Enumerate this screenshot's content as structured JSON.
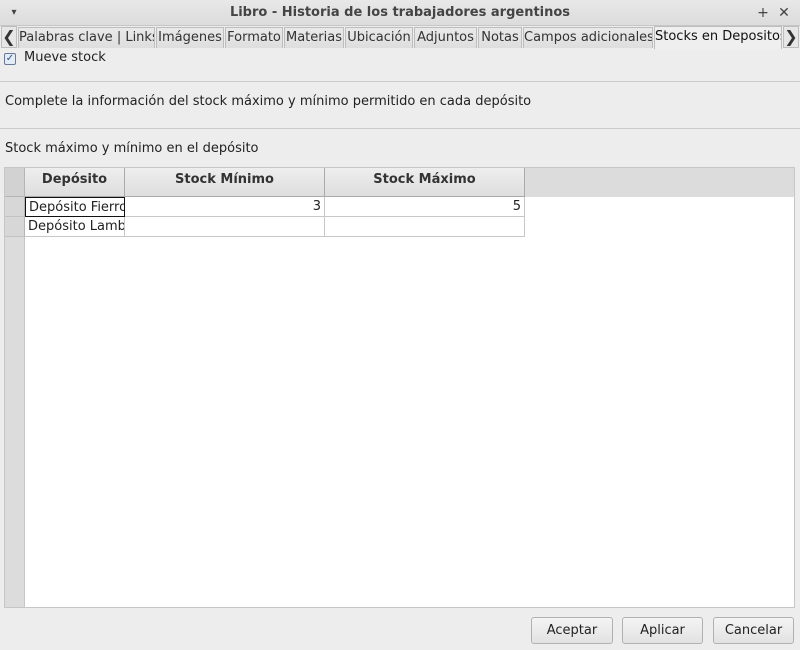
{
  "window": {
    "title": "Libro - Historia de los trabajadores argentinos",
    "menu_glyph": "▾",
    "maximize_glyph": "+",
    "close_glyph": "✕"
  },
  "tabs": {
    "left_arrow": "❮",
    "right_arrow": "❯",
    "items": [
      {
        "label": "Palabras clave | Links"
      },
      {
        "label": "Imágenes"
      },
      {
        "label": "Formato"
      },
      {
        "label": "Materias"
      },
      {
        "label": "Ubicación"
      },
      {
        "label": "Adjuntos"
      },
      {
        "label": "Notas"
      },
      {
        "label": "Campos adicionales"
      },
      {
        "label": "Stocks en Depositos"
      }
    ],
    "active": "Stocks en Depositos"
  },
  "form": {
    "checkbox_label": "Mueve stock",
    "checkbox_checked": true,
    "check_glyph": "✓",
    "info_text": "Complete la información del stock máximo y mínimo permitido en cada depósito",
    "section_label": "Stock máximo y mínimo en el depósito"
  },
  "table": {
    "columns": [
      "Depósito",
      "Stock Mínimo",
      "Stock Máximo"
    ],
    "rows": [
      {
        "deposito": "Depósito Fierro",
        "stock_minimo": "3",
        "stock_maximo": "5"
      },
      {
        "deposito": "Depósito Lambda",
        "stock_minimo": "",
        "stock_maximo": ""
      }
    ]
  },
  "buttons": {
    "accept": "Aceptar",
    "apply": "Aplicar",
    "cancel": "Cancelar"
  }
}
